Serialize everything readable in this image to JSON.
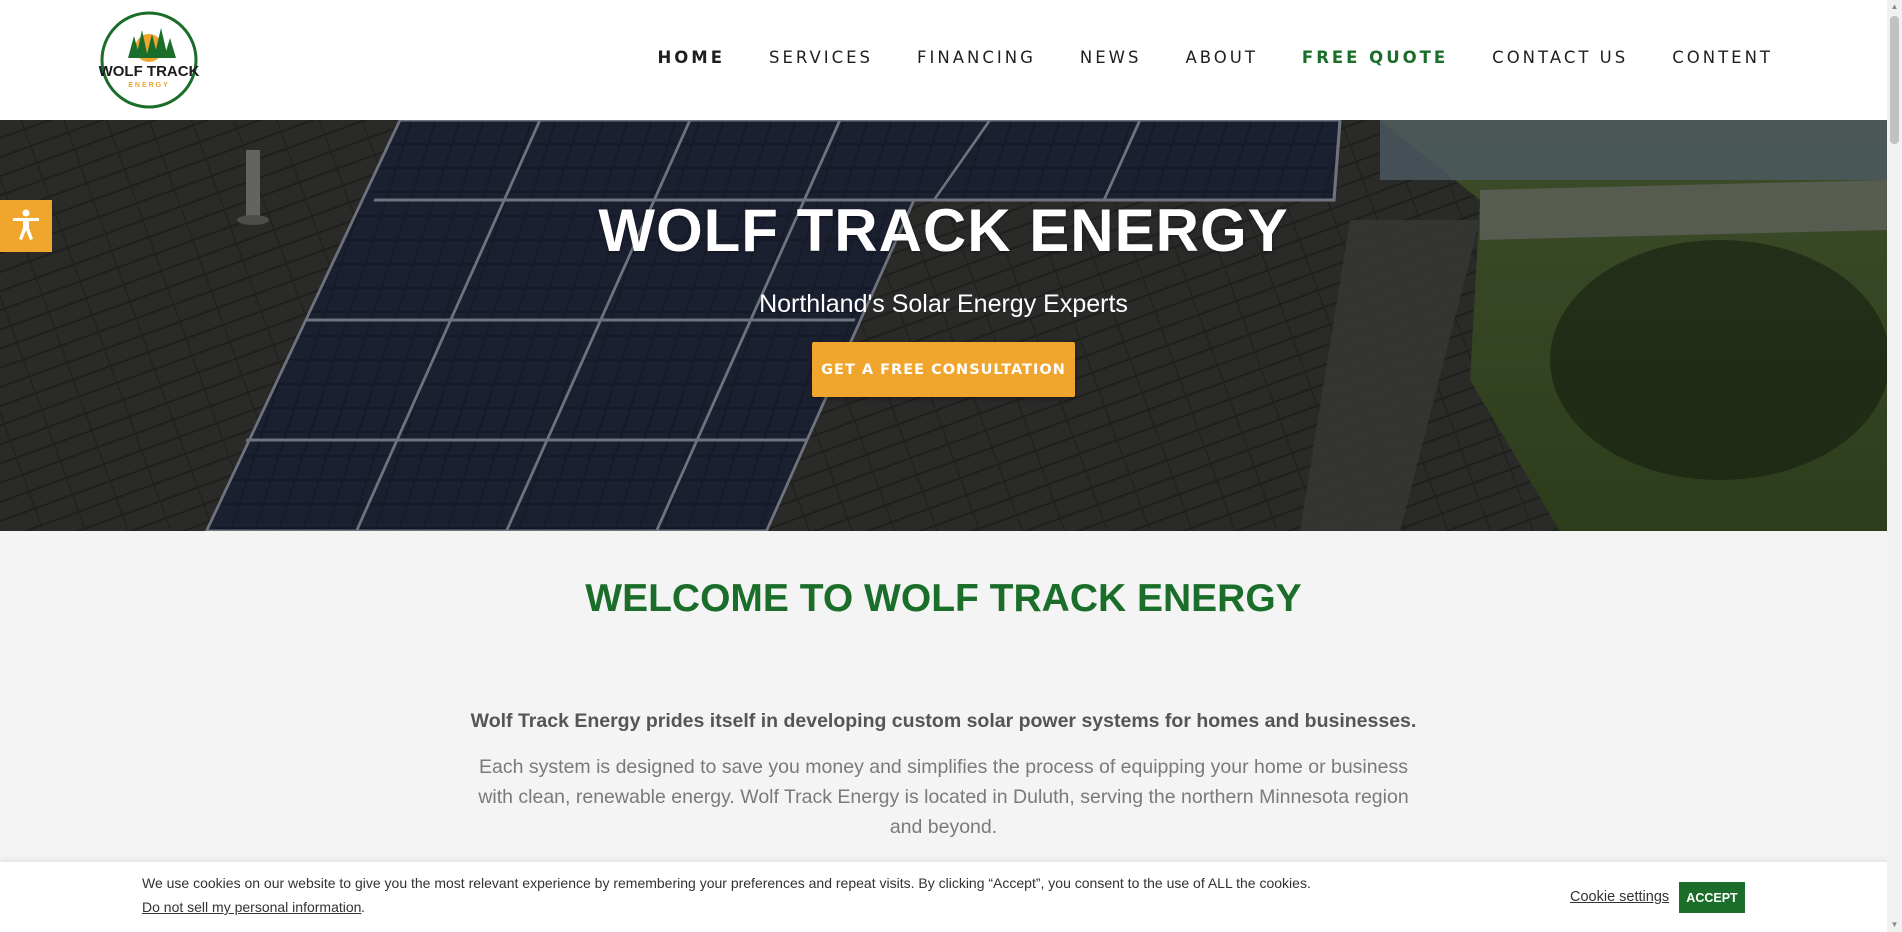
{
  "brand": {
    "logo_text": "WOLF TRACK",
    "logo_subtext": "ENERGY",
    "colors": {
      "green": "#1b6e2a",
      "orange": "#f0a52d"
    }
  },
  "nav": {
    "items": [
      {
        "label": "HOME"
      },
      {
        "label": "SERVICES"
      },
      {
        "label": "FINANCING"
      },
      {
        "label": "NEWS"
      },
      {
        "label": "ABOUT"
      },
      {
        "label": "FREE QUOTE"
      },
      {
        "label": "CONTACT US"
      },
      {
        "label": "CONTENT"
      }
    ]
  },
  "hero": {
    "title": "WOLF TRACK ENERGY",
    "subtitle": "Northland's Solar Energy Experts",
    "cta_label": "GET A FREE CONSULTATION"
  },
  "accessibility": {
    "icon": "accessibility-icon"
  },
  "main": {
    "heading": "WELCOME TO WOLF TRACK ENERGY",
    "lead": "Wolf Track Energy prides itself in developing custom solar power systems for homes and businesses.",
    "description": "Each system is designed to save you money and simplifies the process of equipping your home or business with clean, renewable energy. Wolf Track Energy is located in Duluth, serving the northern Minnesota region and beyond."
  },
  "cookie": {
    "text": "We use cookies on our website to give you the most relevant experience by remembering your preferences and repeat visits. By clicking “Accept”, you consent to the use of ALL the cookies.",
    "do_not_sell": "Do not sell my personal information",
    "settings_label": "Cookie settings",
    "accept_label": "ACCEPT"
  }
}
